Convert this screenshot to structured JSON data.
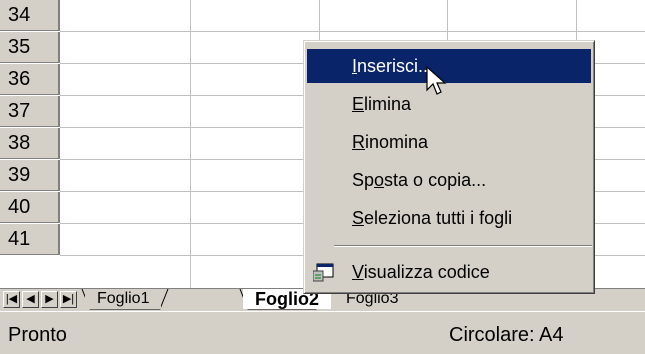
{
  "rows": [
    "34",
    "35",
    "36",
    "37",
    "38",
    "39",
    "40",
    "41"
  ],
  "sheet_tabs": [
    "Foglio1",
    "Foglio2",
    "Foglio3"
  ],
  "active_sheet": "Foglio2",
  "nav_buttons": [
    "first",
    "prev",
    "next",
    "last"
  ],
  "context_menu": {
    "items": [
      {
        "label_u": "I",
        "label_rest": "nserisci...",
        "highlighted": true
      },
      {
        "label_u": "E",
        "label_rest": "limina"
      },
      {
        "label_u": "R",
        "label_rest": "inomina"
      },
      {
        "label_pre": "Sp",
        "label_u": "o",
        "label_rest": "sta o copia..."
      },
      {
        "label_u": "S",
        "label_rest": "eleziona tutti i fogli"
      },
      {
        "label_u": "V",
        "label_rest": "isualizza codice",
        "icon": "code-icon"
      }
    ]
  },
  "status": {
    "left": "Pronto",
    "right": "Circolare: A4"
  },
  "colors": {
    "highlight": "#0a246a",
    "face": "#d4d0c8"
  }
}
